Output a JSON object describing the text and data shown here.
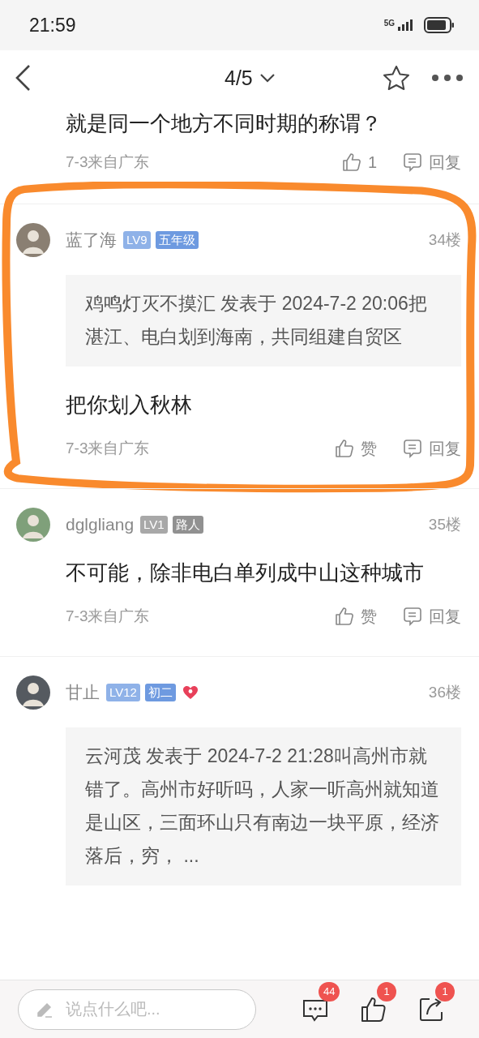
{
  "status_bar": {
    "time": "21:59",
    "network": "5G"
  },
  "nav": {
    "title": "4/5"
  },
  "previous_comment": {
    "text": "就是同一个地方不同时期的称谓？",
    "date": "7-3来自广东",
    "like": "1",
    "reply": "回复"
  },
  "comments": [
    {
      "username": "蓝了海",
      "level": {
        "text": "LV9",
        "color": "#8fb2e8"
      },
      "grade": {
        "text": "五年级",
        "color": "#6e9ae0"
      },
      "heart": false,
      "floor": "34楼",
      "quote": "鸡鸣灯灭不摸汇 发表于 2024-7-2 20:06把湛江、电白划到海南，共同组建自贸区",
      "text": "把你划入秋林",
      "date": "7-3来自广东",
      "like": "赞",
      "reply": "回复",
      "highlighted": true
    },
    {
      "username": "dglgliang",
      "level": {
        "text": "LV1",
        "color": "#a8a8a8"
      },
      "grade": {
        "text": "路人",
        "color": "#919191"
      },
      "heart": false,
      "floor": "35楼",
      "text": "不可能，除非电白单列成中山这种城市",
      "date": "7-3来自广东",
      "like": "赞",
      "reply": "回复",
      "highlighted": false
    },
    {
      "username": "甘止",
      "level": {
        "text": "LV12",
        "color": "#8fb2e8"
      },
      "grade": {
        "text": "初二",
        "color": "#6e9ae0"
      },
      "heart": true,
      "floor": "36楼",
      "quote": "云河茂 发表于 2024-7-2 21:28叫高州市就错了。高州市好听吗，人家一听高州就知道是山区，三面环山只有南边一块平原，经济落后，穷， ...",
      "highlighted": false
    }
  ],
  "bottom_bar": {
    "placeholder": "说点什么吧...",
    "comments_badge": "44",
    "likes_badge": "1",
    "shares_badge": "1"
  }
}
